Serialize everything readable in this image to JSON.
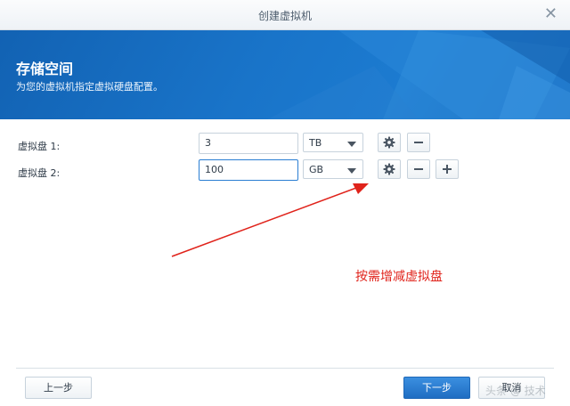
{
  "window": {
    "title": "创建虚拟机"
  },
  "banner": {
    "title": "存储空间",
    "subtitle": "为您的虚拟机指定虚拟硬盘配置。"
  },
  "disks": [
    {
      "label": "虚拟盘 1:",
      "size": "3",
      "unit": "TB"
    },
    {
      "label": "虚拟盘 2:",
      "size": "100",
      "unit": "GB"
    }
  ],
  "annotation": {
    "text": "按需增减虚拟盘",
    "color": "#e0231b"
  },
  "footer": {
    "back_label": "上一步",
    "next_label": "下一步",
    "cancel_label": "取消"
  },
  "watermark": "头条 @ 技术",
  "colors": {
    "accent": "#1f6dc2",
    "banner": "#1974c9",
    "arrow": "#e0231b"
  },
  "icons": [
    "close-icon",
    "gear-icon",
    "minus-icon",
    "plus-icon",
    "chevron-down-icon"
  ]
}
